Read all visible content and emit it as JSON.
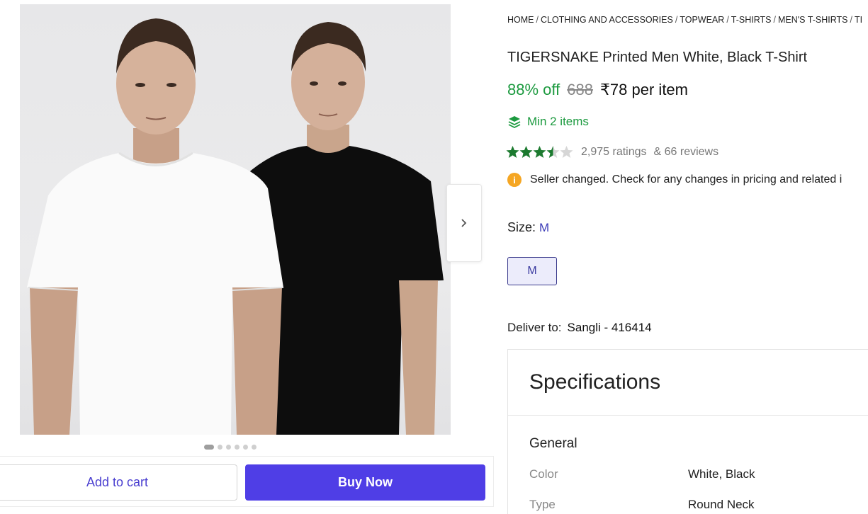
{
  "gallery": {
    "dots_count": 6,
    "active_dot": 0
  },
  "actions": {
    "add_to_cart": "Add to cart",
    "buy_now": "Buy Now"
  },
  "breadcrumb": [
    "HOME",
    "CLOTHING AND ACCESSORIES",
    "TOPWEAR",
    "T-SHIRTS",
    "MEN'S T-SHIRTS",
    "TI"
  ],
  "product": {
    "title": "TIGERSNAKE Printed Men White, Black T-Shirt",
    "discount": "88% off",
    "mrp": "688",
    "price": "₹78 per item",
    "min_items": "Min 2 items",
    "rating_value": 3.5,
    "ratings": "2,975 ratings",
    "reviews": "& 66 reviews",
    "notice": "Seller changed. Check for any changes in pricing and related i"
  },
  "size": {
    "label": "Size:",
    "selected": "M",
    "options": [
      "M"
    ]
  },
  "delivery": {
    "label": "Deliver to:",
    "location": "Sangli - 416414"
  },
  "specifications": {
    "heading": "Specifications",
    "group": "General",
    "rows": [
      {
        "key": "Color",
        "value": "White, Black"
      },
      {
        "key": "Type",
        "value": "Round Neck"
      }
    ]
  },
  "colors": {
    "green": "#1c9a3f",
    "primary": "#4f3ee6",
    "star": "#1c7a2f"
  }
}
